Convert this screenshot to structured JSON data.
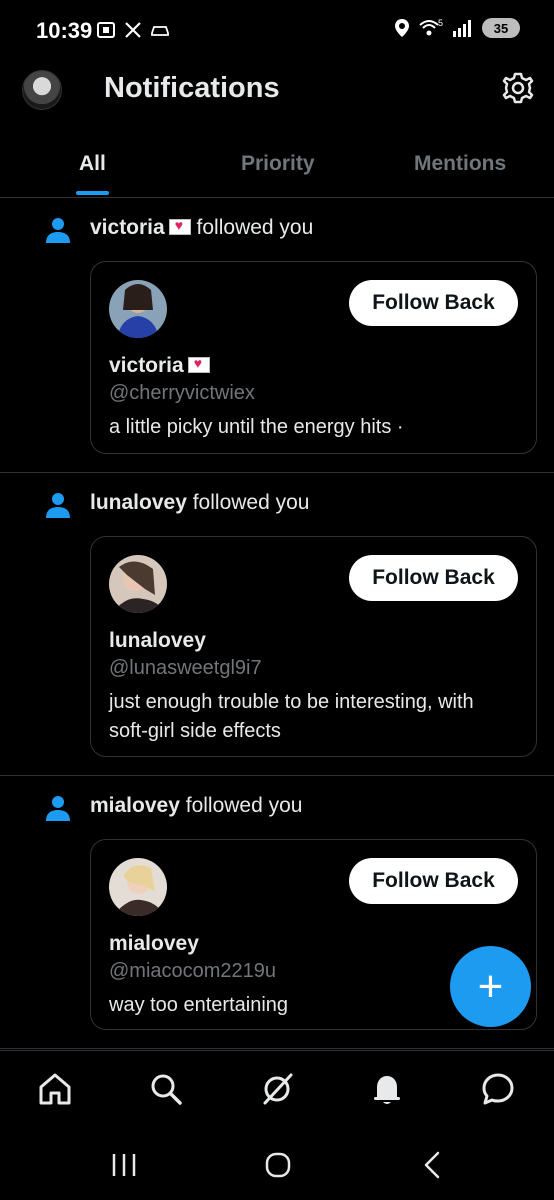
{
  "status_bar": {
    "time": "10:39",
    "battery": "35",
    "network": "5"
  },
  "header": {
    "title": "Notifications"
  },
  "tabs": [
    {
      "label": "All",
      "active": true
    },
    {
      "label": "Priority",
      "active": false
    },
    {
      "label": "Mentions",
      "active": false
    }
  ],
  "notifications": [
    {
      "name": "victoria",
      "action": "followed you",
      "card_name": "victoria",
      "handle": "@cherryvictwiex",
      "bio": "a little picky until the energy hits ·",
      "button": "Follow Back"
    },
    {
      "name": "lunalovey",
      "action": "followed you",
      "card_name": "lunalovey",
      "handle": "@lunasweetgl9i7",
      "bio": "just enough trouble to be interesting, with soft-girl side effects",
      "button": "Follow Back"
    },
    {
      "name": "mialovey",
      "action": "followed you",
      "card_name": "mialovey",
      "handle": "@miacocom2219u",
      "bio": "way too entertaining",
      "button": "Follow Back"
    }
  ],
  "fab": {
    "label": "+"
  },
  "colors": {
    "accent": "#1d9bf0",
    "background": "#000000",
    "secondary_text": "#71767b"
  },
  "icons": [
    "home-icon",
    "search-icon",
    "grok-icon",
    "bell-icon",
    "messages-icon"
  ]
}
